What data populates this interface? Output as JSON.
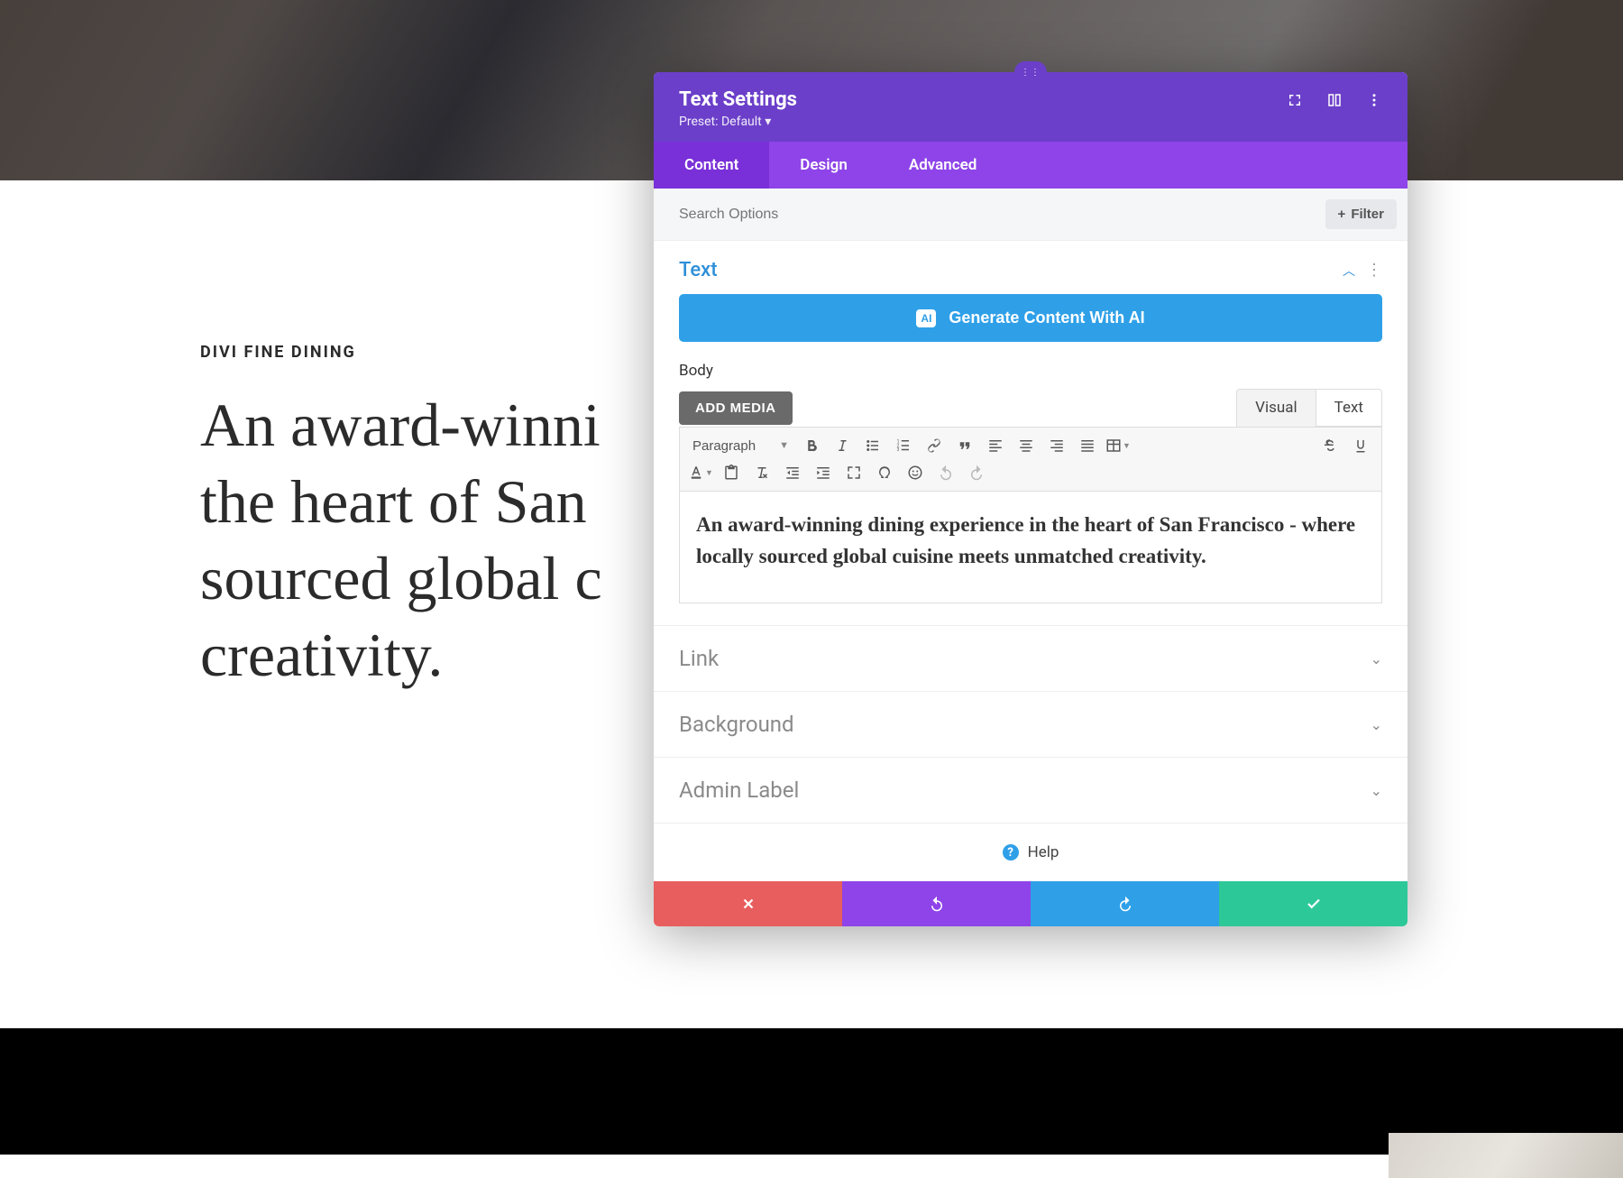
{
  "page": {
    "eyebrow": "DIVI FINE DINING",
    "headline": "An award-winning dining experience in the heart of San Francisco - where locally sourced global cuisine meets unmatched creativity."
  },
  "modal": {
    "title": "Text Settings",
    "preset_label": "Preset: Default",
    "tabs": [
      "Content",
      "Design",
      "Advanced"
    ],
    "active_tab": 0,
    "search_placeholder": "Search Options",
    "filter_label": "Filter",
    "text_section": {
      "label": "Text",
      "ai_button": "Generate Content With AI",
      "ai_badge": "AI",
      "body_label": "Body",
      "add_media": "ADD MEDIA",
      "editor_tabs": [
        "Visual",
        "Text"
      ],
      "active_editor_tab": 0,
      "paragraph_select": "Paragraph",
      "content": "An award-winning dining experience in the heart of San Francisco - where locally sourced global cuisine meets unmatched creativity."
    },
    "collapsed_sections": [
      "Link",
      "Background",
      "Admin Label"
    ],
    "help": "Help"
  },
  "colors": {
    "purple_dark": "#6b3fc9",
    "purple_light": "#8e44e8",
    "blue": "#2fa0e8",
    "green": "#2dc898",
    "red": "#e85e5e"
  }
}
